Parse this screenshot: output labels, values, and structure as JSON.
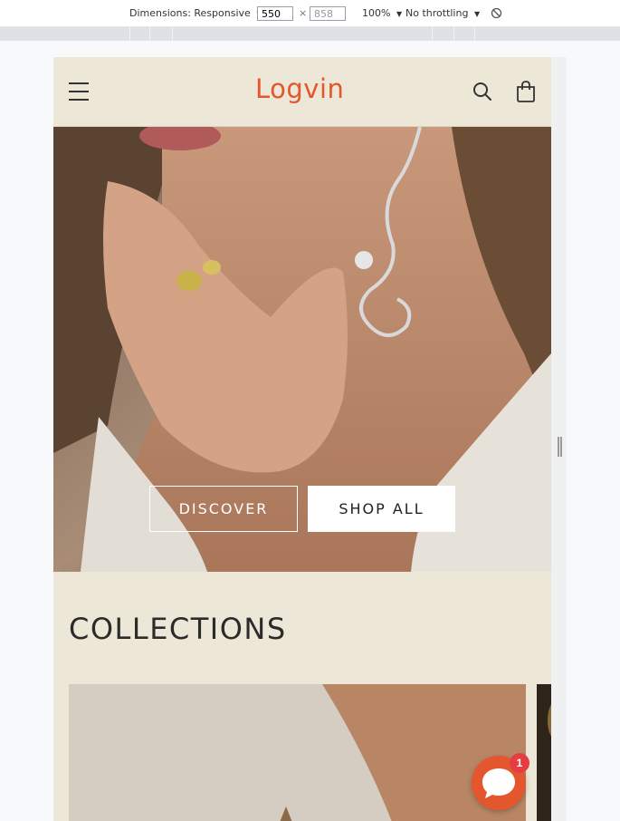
{
  "devtools": {
    "dimensions_label": "Dimensions: Responsive",
    "width_value": "550",
    "height_value": "858",
    "times_sign": "×",
    "zoom_label": "100%",
    "throttle_label": "No throttling"
  },
  "store": {
    "logo_text": "Logvin",
    "brand_color": "#e4572e"
  },
  "hero": {
    "discover_label": "DISCOVER",
    "shop_all_label": "SHOP ALL"
  },
  "collections": {
    "title": "COLLECTIONS"
  },
  "chat": {
    "badge_count": "1"
  },
  "icons": [
    "menu-icon",
    "search-icon",
    "cart-icon",
    "chat-icon",
    "rotate-icon"
  ]
}
